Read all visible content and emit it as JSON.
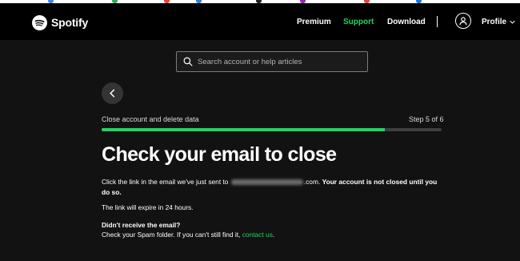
{
  "header": {
    "brand": "Spotify",
    "nav": {
      "premium": "Premium",
      "support": "Support",
      "download": "Download"
    },
    "profile_label": "Profile"
  },
  "search": {
    "placeholder": "Search account or help articles"
  },
  "flow": {
    "step_title": "Close account and delete data",
    "step_count": "Step 5 of 6",
    "progress_fraction": 0.833
  },
  "content": {
    "heading": "Check your email to close",
    "sent_prefix": "Click the link in the email we've just sent to ",
    "email_visible_suffix": ".com.",
    "not_closed_note": "Your account is not closed until you do so.",
    "expiry_note": "The link will expire in 24 hours.",
    "not_received_heading": "Didn't receive the email?",
    "spam_hint": "Check your Spam folder. If you can't still find it, ",
    "contact_link": "contact us",
    "contact_suffix": "."
  },
  "colors": {
    "accent": "#1ed760",
    "background": "#121212",
    "header_bg": "#000000"
  },
  "icons": {
    "logo": "spotify-logo-icon",
    "avatar": "user-icon",
    "profile_caret": "chevron-down-icon",
    "search": "search-icon",
    "back": "chevron-left-icon"
  }
}
